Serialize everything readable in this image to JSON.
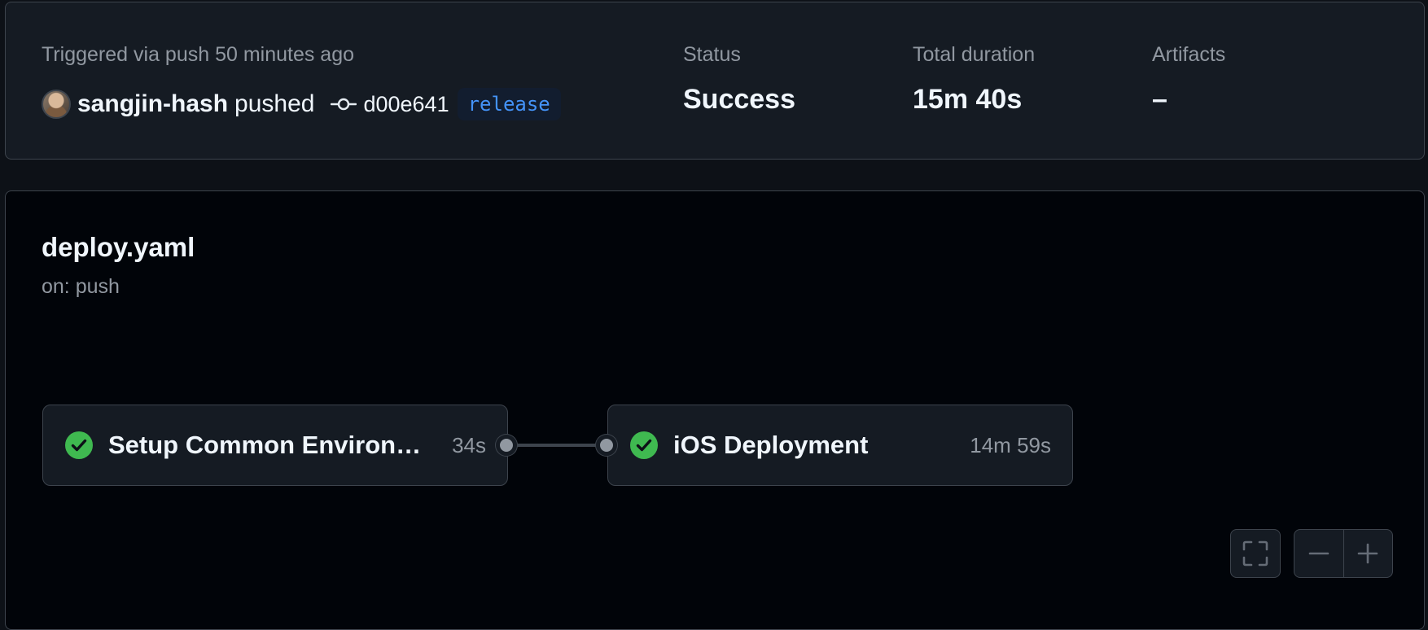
{
  "summary": {
    "trigger_text": "Triggered via push 50 minutes ago",
    "user": "sangjin-hash",
    "action": "pushed",
    "commit_icon": "git-commit-icon",
    "commit_sha": "d00e641",
    "branch": "release",
    "status_label": "Status",
    "status_value": "Success",
    "duration_label": "Total duration",
    "duration_value": "15m 40s",
    "artifacts_label": "Artifacts",
    "artifacts_value": "–"
  },
  "workflow": {
    "file_name": "deploy.yaml",
    "trigger": "on: push",
    "jobs": [
      {
        "name": "Setup Common Environm...",
        "duration": "34s",
        "status": "success",
        "icon": "check-circle-icon"
      },
      {
        "name": "iOS Deployment",
        "duration": "14m 59s",
        "status": "success",
        "icon": "check-circle-icon"
      }
    ]
  },
  "controls": {
    "fullscreen_icon": "fullscreen-icon",
    "zoom_out_icon": "zoom-out-icon",
    "zoom_in_icon": "zoom-in-icon"
  },
  "colors": {
    "page_background": "#0d1117",
    "card_background": "#151b23",
    "graph_background": "#010409",
    "border": "#3d444d",
    "muted_text": "#9198a1",
    "primary_text": "#f0f6fc",
    "success": "#3fb950",
    "branch_accent": "#4493f8"
  }
}
